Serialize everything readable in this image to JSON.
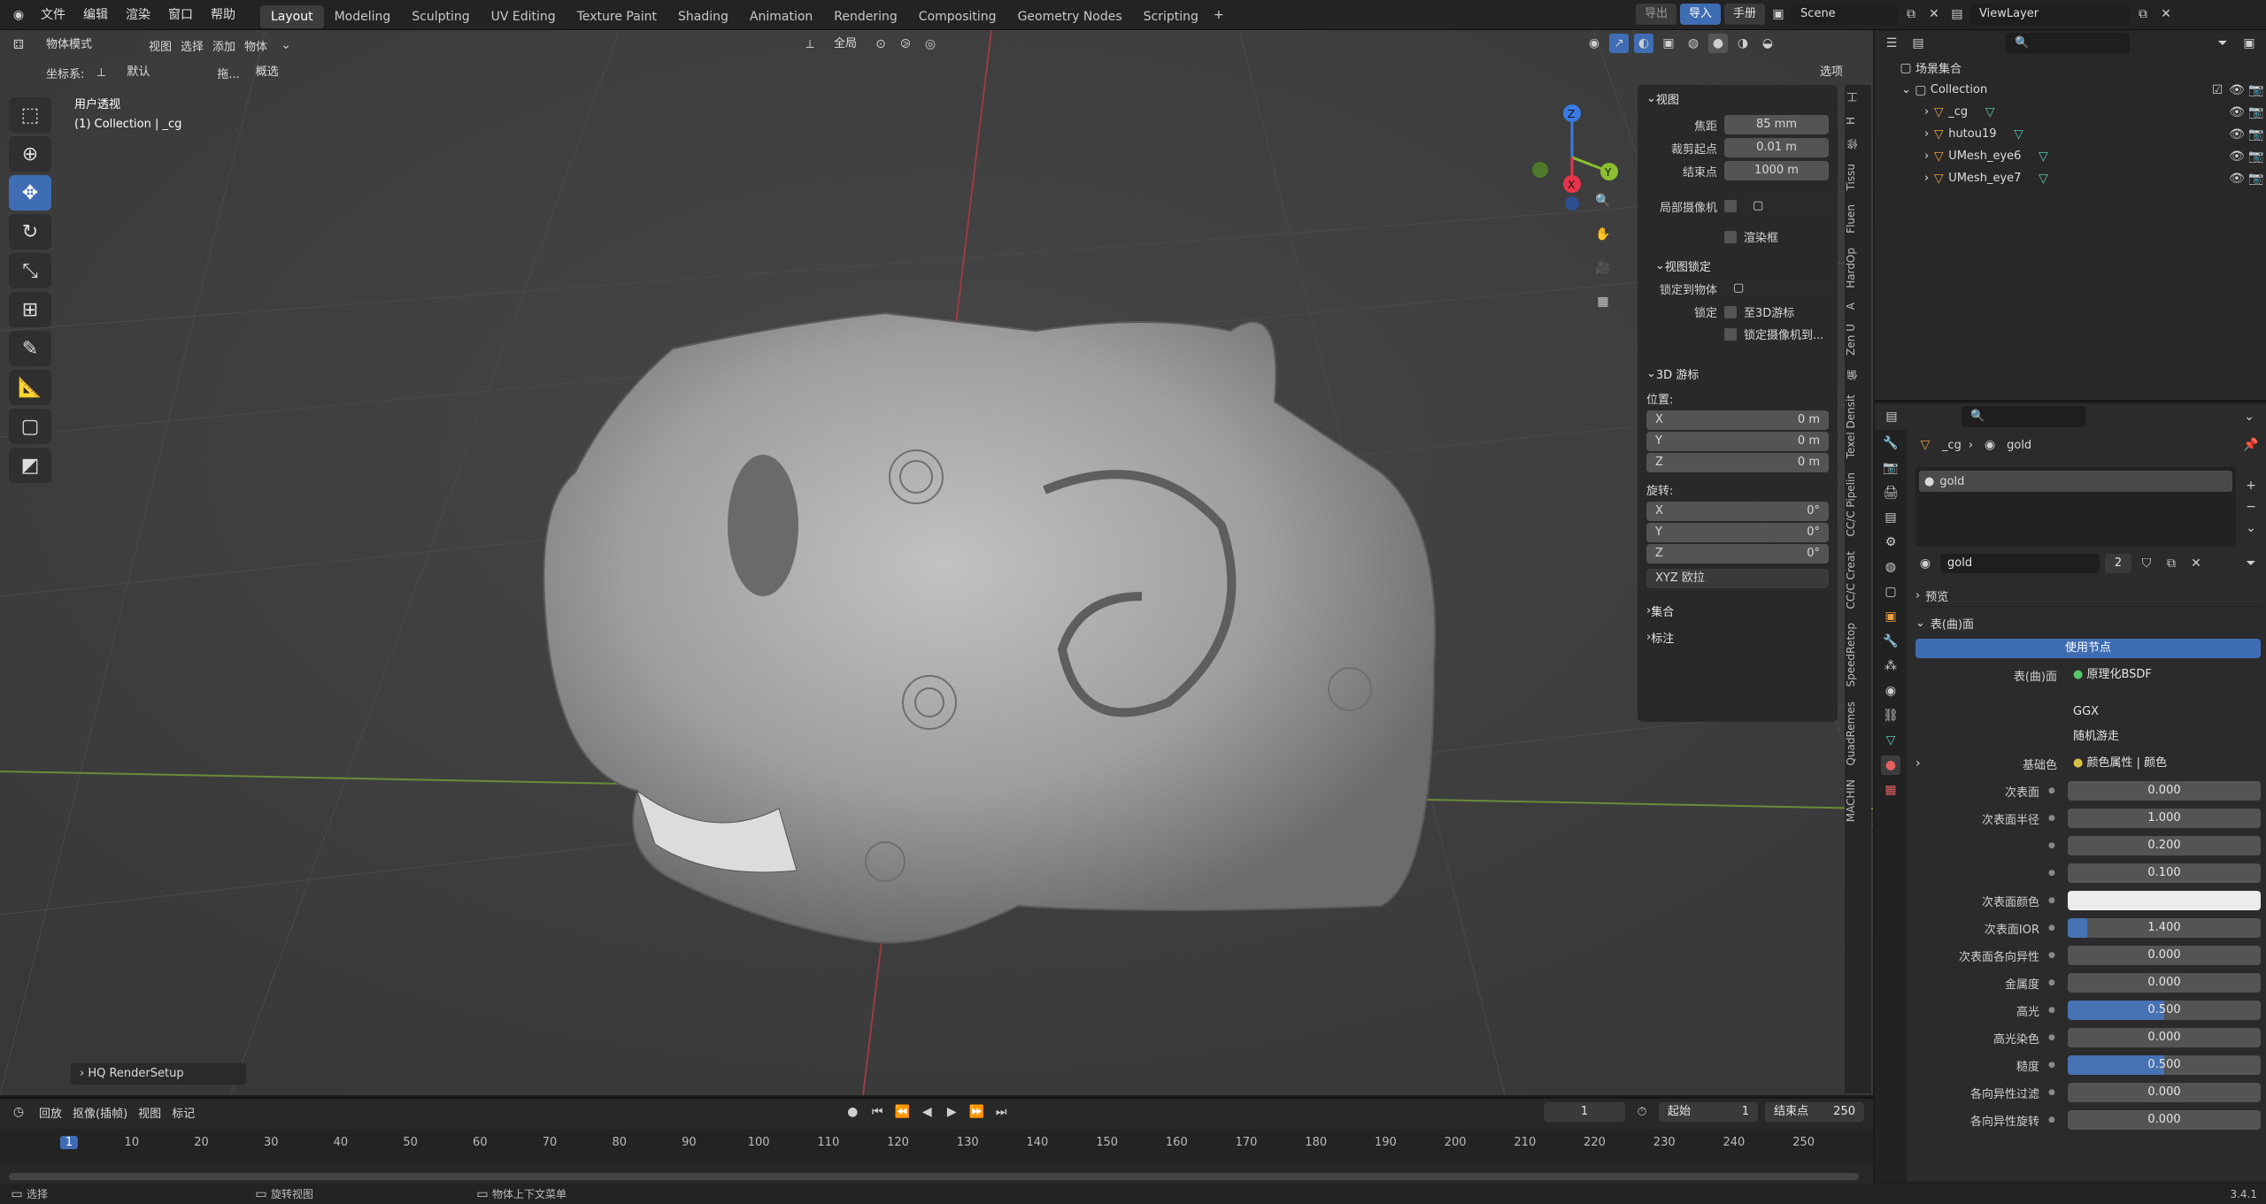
{
  "menu": {
    "items": [
      "文件",
      "编辑",
      "渲染",
      "窗口",
      "帮助"
    ]
  },
  "workspaces": [
    "Layout",
    "Modeling",
    "Sculpting",
    "UV Editing",
    "Texture Paint",
    "Shading",
    "Animation",
    "Rendering",
    "Compositing",
    "Geometry Nodes",
    "Scripting"
  ],
  "workspace_active": "Layout",
  "topright": {
    "export": "导出",
    "import": "导入",
    "manual": "手册",
    "scene": "Scene",
    "view_layer": "ViewLayer"
  },
  "vp_header": {
    "mode": "物体模式",
    "view": "视图",
    "select": "选择",
    "add": "添加",
    "object": "物体",
    "transform": "全局",
    "options": "选项"
  },
  "vp_header2": {
    "coord_label": "坐标系:",
    "coord_value": "默认",
    "drag_label": "拖...",
    "drag_value": "概选"
  },
  "viewport": {
    "view_name": "用户透视",
    "collection_info": "(1) Collection | _cg",
    "popup": "HQ RenderSetup"
  },
  "npanel": {
    "view_title": "视图",
    "focal_label": "焦距",
    "focal_value": "85 mm",
    "clip_start_label": "裁剪起点",
    "clip_start_value": "0.01 m",
    "clip_end_label": "结束点",
    "clip_end_value": "1000 m",
    "local_camera_label": "局部摄像机",
    "render_region_label": "渲染框",
    "view_lock_title": "视图锁定",
    "lock_object_label": "锁定到物体",
    "lock_label": "锁定",
    "lock_cursor_label": "至3D游标",
    "lock_camera_label": "锁定摄像机到...",
    "cursor_title": "3D 游标",
    "location_label": "位置:",
    "rotation_label": "旋转:",
    "loc": [
      {
        "axis": "X",
        "value": "0 m"
      },
      {
        "axis": "Y",
        "value": "0 m"
      },
      {
        "axis": "Z",
        "value": "0 m"
      }
    ],
    "rot": [
      {
        "axis": "X",
        "value": "0°"
      },
      {
        "axis": "Y",
        "value": "0°"
      },
      {
        "axis": "Z",
        "value": "0°"
      }
    ],
    "rotation_mode": "XYZ 欧拉",
    "collection_title": "集合",
    "annotation_title": "标注"
  },
  "sidetabs": [
    "工",
    "H",
    "修",
    "Tissu",
    "Fluen",
    "HardOp",
    "A",
    "Zen U",
    "偏",
    "Texel Densit",
    "CC/C Pipelin",
    "CC/C Creat",
    "SpeedRetop",
    "QuadRemes",
    "MACHIN"
  ],
  "outliner": {
    "scene_collection": "场景集合",
    "collection": "Collection",
    "items": [
      {
        "name": "_cg"
      },
      {
        "name": "hutou19"
      },
      {
        "name": "UMesh_eye6"
      },
      {
        "name": "UMesh_eye7"
      }
    ]
  },
  "props": {
    "breadcrumb_obj": "_cg",
    "breadcrumb_mat": "gold",
    "slot_name": "gold",
    "material_name": "gold",
    "users": "2",
    "preview_title": "预览",
    "surface_title": "表(曲)面",
    "use_nodes": "使用节点",
    "surface_label": "表(曲)面",
    "shader": "原理化BSDF",
    "distribution": "GGX",
    "subsurface_method": "随机游走",
    "base_color_label": "基础色",
    "base_color_value": "颜色属性 | 颜色",
    "rows": [
      {
        "label": "次表面",
        "value": "0.000",
        "fill": 0
      },
      {
        "label": "次表面半径",
        "value": "1.000",
        "fill": 0
      },
      {
        "label": "",
        "value": "0.200",
        "fill": 0
      },
      {
        "label": "",
        "value": "0.100",
        "fill": 0
      },
      {
        "label": "次表面颜色",
        "value": "",
        "fill": 0
      },
      {
        "label": "次表面IOR",
        "value": "1.400",
        "fill": 0.1
      },
      {
        "label": "次表面各向异性",
        "value": "0.000",
        "fill": 0
      },
      {
        "label": "金属度",
        "value": "0.000",
        "fill": 0
      },
      {
        "label": "高光",
        "value": "0.500",
        "fill": 0.5
      },
      {
        "label": "高光染色",
        "value": "0.000",
        "fill": 0
      },
      {
        "label": "糙度",
        "value": "0.500",
        "fill": 0.5
      },
      {
        "label": "各向异性过滤",
        "value": "0.000",
        "fill": 0
      },
      {
        "label": "各向异性旋转",
        "value": "0.000",
        "fill": 0
      }
    ]
  },
  "timeline": {
    "playback": "回放",
    "keying": "抠像(插帧)",
    "view": "视图",
    "marker": "标记",
    "current_frame": "1",
    "start_label": "起始",
    "start_value": "1",
    "end_label": "结束点",
    "end_value": "250",
    "ticks": [
      "1",
      "10",
      "20",
      "30",
      "40",
      "50",
      "60",
      "70",
      "80",
      "90",
      "100",
      "110",
      "120",
      "130",
      "140",
      "150",
      "160",
      "170",
      "180",
      "190",
      "200",
      "210",
      "220",
      "230",
      "240",
      "250"
    ]
  },
  "status": {
    "select": "选择",
    "rotate": "旋转视图",
    "context": "物体上下文菜单",
    "version": "3.4.1"
  },
  "colors": {
    "accent": "#3f6db3",
    "axis_x": "#e8344a",
    "axis_y": "#8bbf2e",
    "axis_z": "#3a7ae2"
  }
}
